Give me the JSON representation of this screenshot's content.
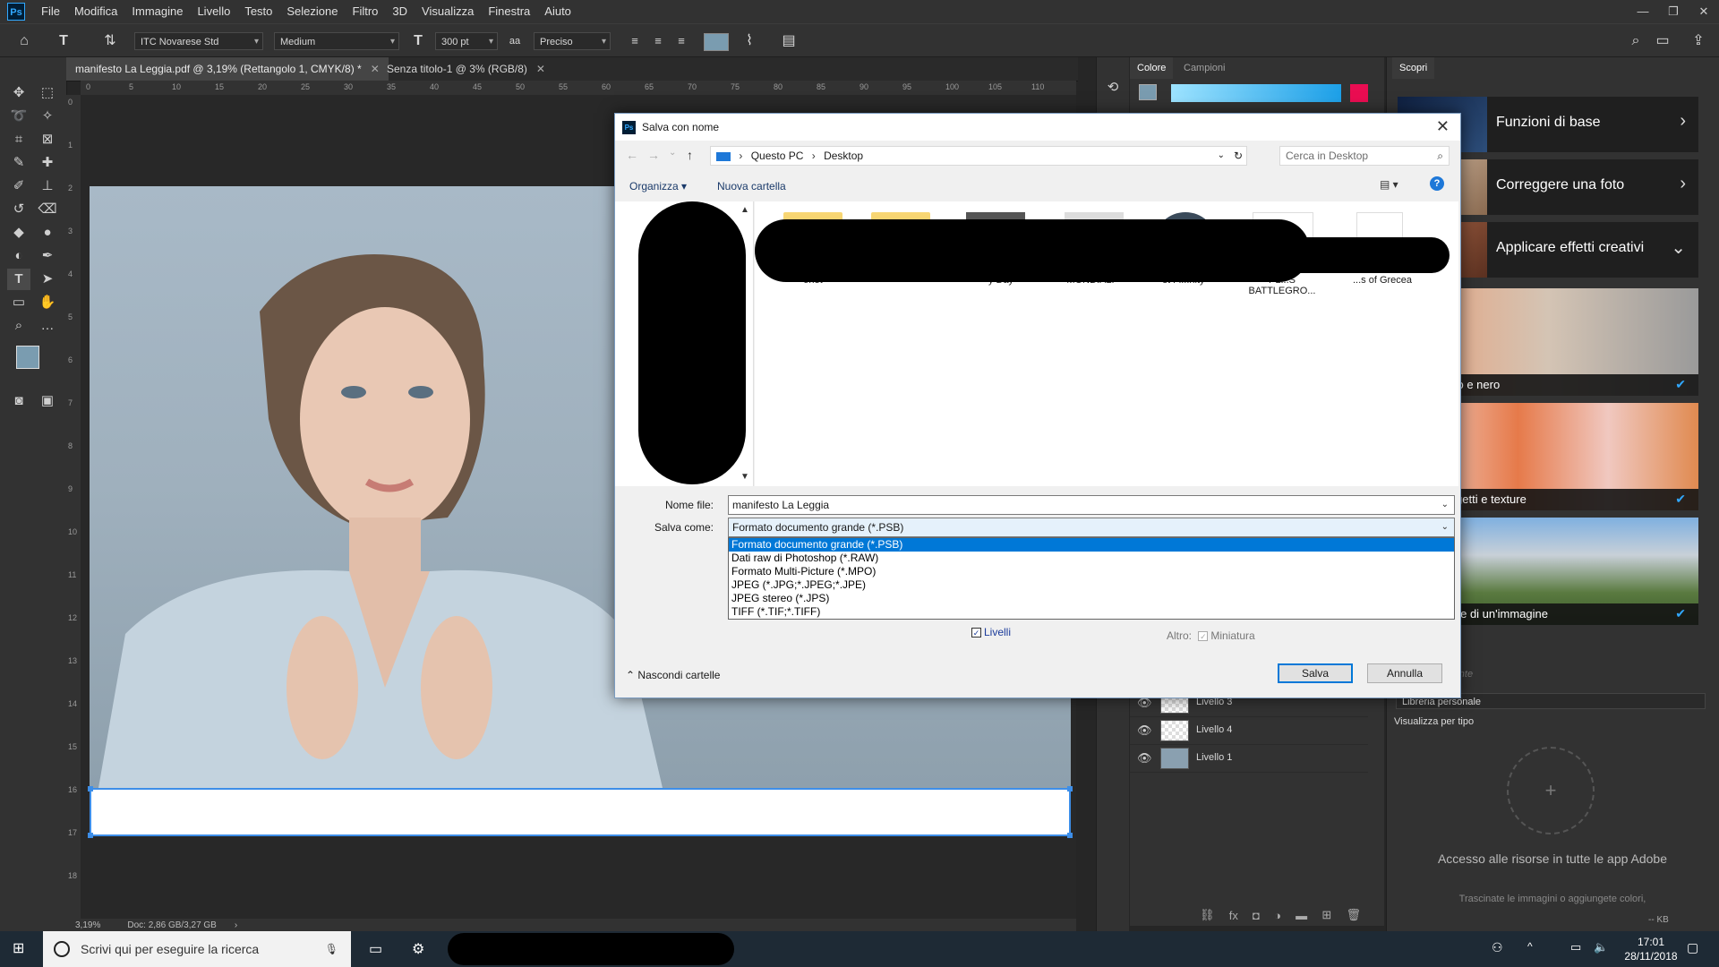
{
  "menu": {
    "items": [
      "File",
      "Modifica",
      "Immagine",
      "Livello",
      "Testo",
      "Selezione",
      "Filtro",
      "3D",
      "Visualizza",
      "Finestra",
      "Aiuto"
    ]
  },
  "options": {
    "font_family": "ITC Novarese Std",
    "font_style": "Medium",
    "font_size": "300 pt",
    "antialias_icon": "aa",
    "antialias": "Preciso"
  },
  "tabs": [
    {
      "label": "manifesto La Leggia.pdf @ 3,19% (Rettangolo 1, CMYK/8) *"
    },
    {
      "label": "Senza titolo-1 @ 3% (RGB/8)"
    }
  ],
  "ruler": {
    "top": [
      "0",
      "5",
      "10",
      "15",
      "20",
      "25",
      "30",
      "35",
      "40",
      "45",
      "50",
      "55",
      "60",
      "65",
      "70",
      "75",
      "80",
      "85",
      "90",
      "95",
      "100",
      "105",
      "110"
    ]
  },
  "status": {
    "zoom": "3,19%",
    "doc": "Doc: 2,86 GB/3,27 GB"
  },
  "panels": {
    "color_tab": "Colore",
    "swatches_tab": "Campioni",
    "discover_tab": "Scopri"
  },
  "discover": {
    "cards": [
      "Funzioni di base",
      "Correggere una foto",
      "Applicare effetti creativi"
    ],
    "images": [
      "zzare bianco e nero",
      "e piccoli oggetti e texture",
      "are una parte di un'immagine"
    ]
  },
  "libraries": {
    "current": "Libreria corrente",
    "personal": "Libreria personale",
    "view_by": "Visualizza per tipo",
    "access_text": "Accesso alle risorse in tutte le app Adobe",
    "drag_text": "Trascinate le immagini o aggiungete colori,",
    "size": "-- KB"
  },
  "layers": [
    "Livello 3",
    "Livello 4",
    "Livello 1"
  ],
  "taskbar": {
    "search_placeholder": "Scrivi qui per eseguire la ricerca",
    "time": "17:01",
    "date": "28/11/2018"
  },
  "dialog": {
    "title": "Salva con nome",
    "breadcrumb_pc": "Questo PC",
    "breadcrumb_folder": "Desktop",
    "search_placeholder": "Cerca in Desktop",
    "organize": "Organizza",
    "new_folder": "Nuova cartella",
    "file_labels": [
      "onet",
      "y Day",
      "MONDIALI",
      "st Fi...nity",
      "PL...S BATTLEGRO...",
      "...s of Grecea"
    ],
    "filename_label": "Nome file:",
    "filename_value": "manifesto La Leggia",
    "savetype_label": "Salva come:",
    "savetype_value": "Formato documento grande (*.PSB)",
    "options": [
      "Formato documento grande (*.PSB)",
      "Dati raw di Photoshop (*.RAW)",
      "Formato Multi-Picture (*.MPO)",
      "JPEG (*.JPG;*.JPEG;*.JPE)",
      "JPEG stereo (*.JPS)",
      "TIFF (*.TIF;*.TIFF)"
    ],
    "layers_check": "Livelli",
    "other_label": "Altro:",
    "thumbnail_check": "Miniatura",
    "hide_folders": "Nascondi cartelle",
    "save_button": "Salva",
    "cancel_button": "Annulla"
  },
  "colors": {
    "accent": "#31a8ff",
    "dialog_accent": "#0078d7"
  }
}
